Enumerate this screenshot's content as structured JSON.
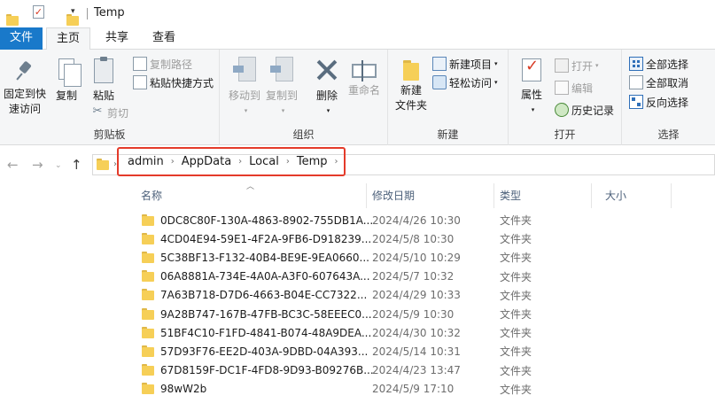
{
  "window": {
    "title": "Temp"
  },
  "tabs": [
    {
      "label": "文件"
    },
    {
      "label": "主页"
    },
    {
      "label": "共享"
    },
    {
      "label": "查看"
    }
  ],
  "ribbon": {
    "clipboard": {
      "label": "剪贴板",
      "pin": "固定到快\n速访问",
      "pin_line1": "固定到快",
      "pin_line2": "速访问",
      "copy": "复制",
      "paste": "粘贴",
      "copy_path": "复制路径",
      "paste_shortcut": "粘贴快捷方式",
      "cut": "剪切"
    },
    "organize": {
      "label": "组织",
      "move_to": "移动到",
      "copy_to": "复制到",
      "delete": "删除",
      "rename": "重命名"
    },
    "new": {
      "label": "新建",
      "new_folder_line1": "新建",
      "new_folder_line2": "文件夹",
      "new_item": "新建项目",
      "easy_access": "轻松访问"
    },
    "open": {
      "label": "打开",
      "properties": "属性",
      "open": "打开",
      "edit": "编辑",
      "history": "历史记录"
    },
    "select": {
      "label": "选择",
      "select_all": "全部选择",
      "select_none": "全部取消",
      "invert": "反向选择"
    }
  },
  "address": {
    "crumbs": [
      "admin",
      "AppData",
      "Local",
      "Temp"
    ]
  },
  "columns": {
    "name": "名称",
    "date": "修改日期",
    "type": "类型",
    "size": "大小"
  },
  "files": [
    {
      "name": "0DC8C80F-130A-4863-8902-755DB1A...",
      "date": "2024/4/26 10:30",
      "type": "文件夹"
    },
    {
      "name": "4CD04E94-59E1-4F2A-9FB6-D918239...",
      "date": "2024/5/8 10:30",
      "type": "文件夹"
    },
    {
      "name": "5C38BF13-F132-40B4-BE9E-9EA0660...",
      "date": "2024/5/10 10:29",
      "type": "文件夹"
    },
    {
      "name": "06A8881A-734E-4A0A-A3F0-607643A...",
      "date": "2024/5/7 10:32",
      "type": "文件夹"
    },
    {
      "name": "7A63B718-D7D6-4663-B04E-CC7322...",
      "date": "2024/4/29 10:33",
      "type": "文件夹"
    },
    {
      "name": "9A28B747-167B-47FB-BC3C-58EEEC0...",
      "date": "2024/5/9 10:30",
      "type": "文件夹"
    },
    {
      "name": "51BF4C10-F1FD-4841-B074-48A9DEA...",
      "date": "2024/4/30 10:32",
      "type": "文件夹"
    },
    {
      "name": "57D93F76-EE2D-403A-9DBD-04A393...",
      "date": "2024/5/14 10:31",
      "type": "文件夹"
    },
    {
      "name": "67D8159F-DC1F-4FD8-9D93-B09276B...",
      "date": "2024/4/23 13:47",
      "type": "文件夹"
    },
    {
      "name": "98wW2b",
      "date": "2024/5/9 17:10",
      "type": "文件夹"
    }
  ]
}
